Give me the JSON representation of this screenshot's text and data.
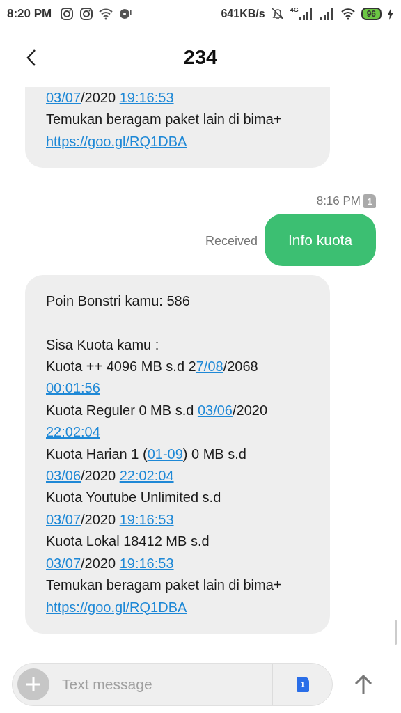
{
  "status_bar": {
    "time": "8:20 PM",
    "speed": "641KB/s",
    "network": "4G",
    "battery": "96"
  },
  "header": {
    "title": "234"
  },
  "messages": [
    {
      "kind": "incoming",
      "clipped_top": true,
      "paragraphs": [
        [
          [
            {
              "text": "03/07",
              "link": true
            },
            {
              "text": "/2020 ",
              "link": false
            },
            {
              "text": "19:16:53",
              "link": true
            }
          ],
          [
            {
              "text": "Temukan beragam paket lain di bima+",
              "link": false
            }
          ],
          [
            {
              "text": "https://goo.gl/RQ1DBA",
              "link": true
            }
          ]
        ]
      ]
    },
    {
      "kind": "outgoing",
      "time": "8:16 PM",
      "sim": "1",
      "status": "Received",
      "text": "Info kuota"
    },
    {
      "kind": "incoming",
      "clipped_top": false,
      "paragraphs": [
        [
          [
            {
              "text": "Poin Bonstri kamu: 586",
              "link": false
            }
          ]
        ],
        [
          [
            {
              "text": "Sisa Kuota kamu :",
              "link": false
            }
          ],
          [
            {
              "text": "Kuota ++ 4096 MB s.d 2",
              "link": false
            },
            {
              "text": "7/08",
              "link": true
            },
            {
              "text": "/2068",
              "link": false
            }
          ],
          [
            {
              "text": "00:01:56",
              "link": true
            }
          ],
          [
            {
              "text": "Kuota Reguler 0 MB s.d ",
              "link": false
            },
            {
              "text": "03/06",
              "link": true
            },
            {
              "text": "/2020",
              "link": false
            }
          ],
          [
            {
              "text": "22:02:04",
              "link": true
            }
          ],
          [
            {
              "text": "Kuota Harian 1 (",
              "link": false
            },
            {
              "text": "01-09",
              "link": true
            },
            {
              "text": ") 0 MB s.d",
              "link": false
            }
          ],
          [
            {
              "text": "03/06",
              "link": true
            },
            {
              "text": "/2020 ",
              "link": false
            },
            {
              "text": "22:02:04",
              "link": true
            }
          ],
          [
            {
              "text": "Kuota Youtube Unlimited s.d",
              "link": false
            }
          ],
          [
            {
              "text": "03/07",
              "link": true
            },
            {
              "text": "/2020 ",
              "link": false
            },
            {
              "text": "19:16:53",
              "link": true
            }
          ],
          [
            {
              "text": "Kuota Lokal 18412 MB s.d",
              "link": false
            }
          ],
          [
            {
              "text": "03/07",
              "link": true
            },
            {
              "text": "/2020 ",
              "link": false
            },
            {
              "text": "19:16:53",
              "link": true
            }
          ],
          [
            {
              "text": "Temukan beragam paket lain di bima+",
              "link": false
            }
          ],
          [
            {
              "text": "https://goo.gl/RQ1DBA",
              "link": true
            }
          ]
        ]
      ]
    }
  ],
  "composer": {
    "placeholder": "Text message",
    "sim": "1"
  }
}
